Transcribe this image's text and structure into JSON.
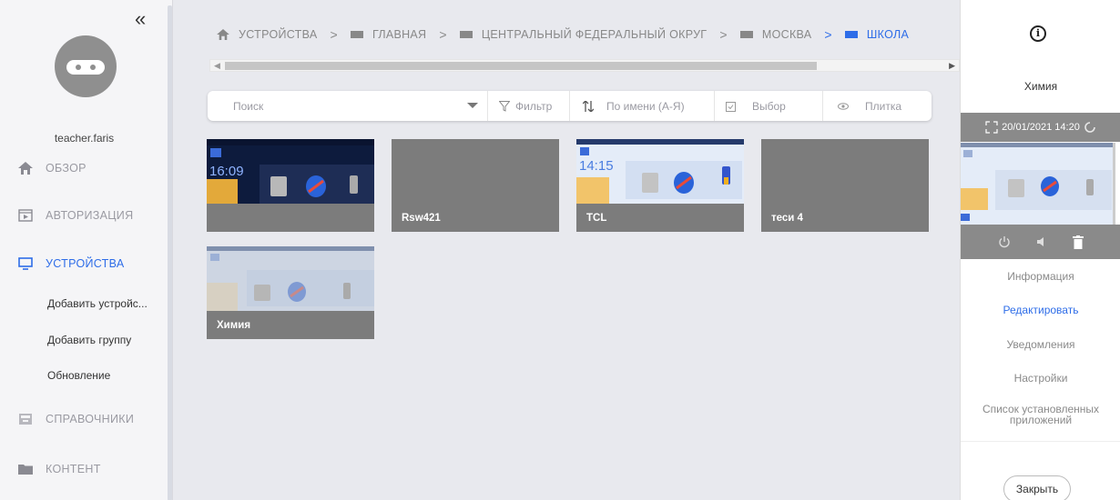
{
  "sidebar": {
    "collapse_icon": "«",
    "username": "teacher.faris",
    "nav": [
      {
        "label": "ОБЗОР",
        "icon": "home-icon"
      },
      {
        "label": "АВТОРИЗАЦИЯ",
        "icon": "play-box-icon"
      },
      {
        "label": "УСТРОЙСТВА",
        "icon": "monitor-icon",
        "active": true
      },
      {
        "label": "СПРАВОЧНИКИ",
        "icon": "tray-icon"
      },
      {
        "label": "КОНТЕНТ",
        "icon": "folder-icon"
      }
    ],
    "sub": [
      "Добавить устройс...",
      "Добавить группу",
      "Обновление"
    ]
  },
  "breadcrumb": [
    {
      "label": "УСТРОЙСТВА"
    },
    {
      "label": "ГЛАВНАЯ"
    },
    {
      "label": "ЦЕНТРАЛЬНЫЙ ФЕДЕРАЛЬНЫЙ ОКРУГ"
    },
    {
      "label": "МОСКВА"
    },
    {
      "label": "ШКОЛА"
    }
  ],
  "toolbar": {
    "search_placeholder": "Поиск",
    "filter": "Фильтр",
    "sort": "По имени (А-Я)",
    "select": "Выбор",
    "view": "Плитка"
  },
  "tiles": [
    {
      "name": "",
      "screen": "dark",
      "time": "16:09"
    },
    {
      "name": "Rsw421",
      "screen": "none"
    },
    {
      "name": "TCL",
      "screen": "light",
      "time": "14:15"
    },
    {
      "name": "теси 4",
      "screen": "none"
    },
    {
      "name": "Химия",
      "screen": "light",
      "time": ""
    }
  ],
  "panel": {
    "title": "Химия",
    "status": "20/01/2021 14:20",
    "links": [
      "Информация",
      "Редактировать",
      "Уведомления",
      "Настройки",
      "Список установленных приложений"
    ],
    "active_link": "Редактировать",
    "close": "Закрыть"
  },
  "colors": {
    "accent": "#2e6de8",
    "tile": "#7c7c7c",
    "panel_bar": "#8a8a8a"
  }
}
